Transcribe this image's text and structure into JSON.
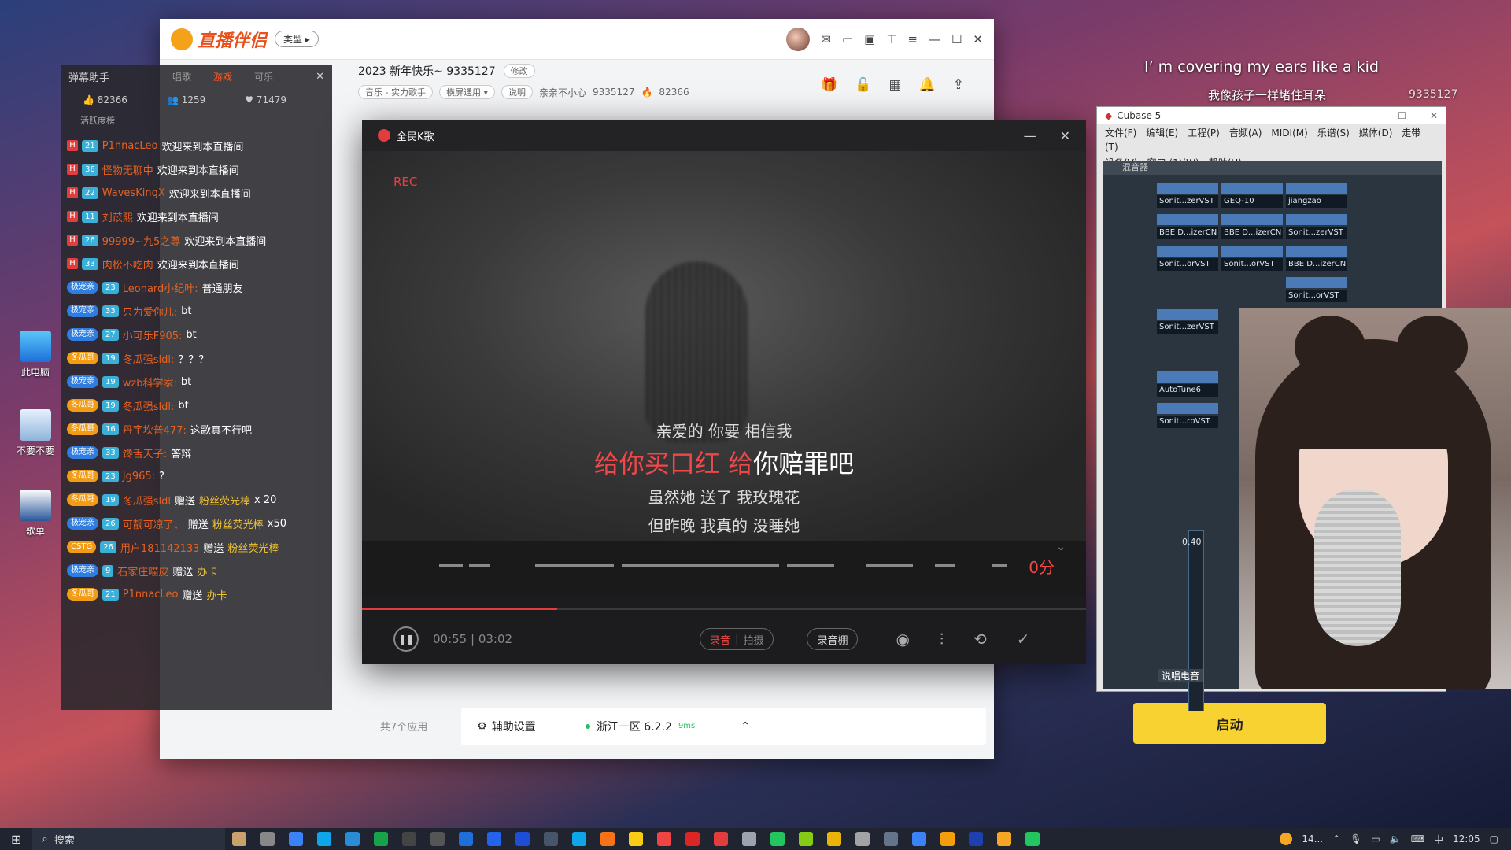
{
  "desktop": {
    "icons": [
      {
        "label": "此电脑"
      },
      {
        "label": "不要不要"
      },
      {
        "label": "歌单"
      }
    ],
    "overlay_lines": [
      "I’ m covering my ears like a kid",
      "我像孩子一样堵住耳朵"
    ],
    "watermark_room": "9335127"
  },
  "main_window": {
    "logo_text": "直播伴侣",
    "type_label": "类型 ▸",
    "chat": {
      "panel_title": "弹幕助手",
      "tabs": [
        "唱歌",
        "游戏",
        "可乐"
      ],
      "active_tab": "游戏",
      "stats": {
        "likes": "82366",
        "viewers": "1259",
        "hearts": "71479"
      },
      "activity_label": "活跃度榜",
      "messages": [
        {
          "kind": "welcome",
          "level": "21",
          "nick": "P1nnacLeo",
          "text": "欢迎来到本直播间"
        },
        {
          "kind": "welcome",
          "level": "36",
          "nick": "怪物无聊中",
          "text": "欢迎来到本直播间"
        },
        {
          "kind": "welcome",
          "level": "22",
          "nick": "WavesKingX",
          "text": "欢迎来到本直播间"
        },
        {
          "kind": "welcome",
          "level": "11",
          "nick": "刘苡熙",
          "text": "欢迎来到本直播间"
        },
        {
          "kind": "welcome",
          "level": "26",
          "nick": "99999~九5之尊",
          "text": "欢迎来到本直播间"
        },
        {
          "kind": "welcome",
          "level": "33",
          "nick": "肉松不吃肉",
          "text": "欢迎来到本直播间"
        },
        {
          "kind": "chat",
          "fan": "极宠亲",
          "level": "23",
          "nick": "Leonard小纪叶:",
          "text": "普通朋友"
        },
        {
          "kind": "chat",
          "fan": "极宠亲",
          "level": "33",
          "nick": "只为爱你儿:",
          "text": "bt"
        },
        {
          "kind": "chat",
          "fan": "极宠亲",
          "level": "27",
          "nick": "小可乐F905:",
          "text": "bt"
        },
        {
          "kind": "chat",
          "fan": "冬瓜哥",
          "level": "19",
          "nick": "冬瓜强sldl:",
          "text": "？？？"
        },
        {
          "kind": "chat",
          "fan": "极宠亲",
          "level": "19",
          "nick": "wzb科学家:",
          "text": "bt"
        },
        {
          "kind": "chat",
          "fan": "冬瓜哥",
          "level": "19",
          "nick": "冬瓜强sldl:",
          "text": "bt"
        },
        {
          "kind": "chat",
          "fan": "冬瓜哥",
          "level": "16",
          "nick": "丹宇坎普477:",
          "text": "这歌真不行吧"
        },
        {
          "kind": "chat",
          "fan": "极宠亲",
          "level": "33",
          "nick": "馋舌天子:",
          "text": "答辩"
        },
        {
          "kind": "chat",
          "fan": "冬瓜哥",
          "level": "23",
          "nick": "Jg965:",
          "text": "?"
        }
      ],
      "gifts": [
        {
          "fan": "冬瓜哥",
          "level": "19",
          "nick": "冬瓜强sldl",
          "verb": "赠送",
          "item": "粉丝荧光棒",
          "qty": "x 20"
        },
        {
          "fan": "极宠亲",
          "level": "26",
          "nick": "可靓可凉了、",
          "verb": "赠送",
          "item": "粉丝荧光棒",
          "qty": "x50"
        },
        {
          "fan": "CSTG",
          "level": "26",
          "nick": "用户181142133",
          "verb": "赠送",
          "item": "粉丝荧光棒",
          "qty": ""
        },
        {
          "fan": "极宠亲",
          "level": "9",
          "nick": "石家庄喵皮",
          "verb": "赠送",
          "item": "办卡",
          "qty": ""
        },
        {
          "fan": "冬瓜哥",
          "level": "21",
          "nick": "P1nnacLeo",
          "verb": "赠送",
          "item": "办卡",
          "qty": ""
        }
      ]
    },
    "room": {
      "title": "2023 新年快乐~ 9335127",
      "edit_label": "修改",
      "category": "音乐 - 实力歌手",
      "layout": "横屏通用 ▾",
      "desc_label": "说明",
      "streamer": "亲亲不小心",
      "room_id": "9335127",
      "heat": "82366"
    },
    "bottom": {
      "apps_count": "共7个应用",
      "assist_label": "辅助设置",
      "server": "浙江一区 6.2.2",
      "ping": "9ms",
      "start_label": "启动"
    }
  },
  "karaoke": {
    "title": "全民K歌",
    "rec_label": "REC",
    "lyrics": {
      "line1": "亲爱的 你要 相信我",
      "line2_sung": "给你买口红 给",
      "line2_rest": "你赔罪吧",
      "line3": "虽然她 送了 我玫瑰花",
      "line4": "但昨晚 我真的 没睡她"
    },
    "score": "0分",
    "progress_fraction": 0.27,
    "time": "00:55 | 03:02",
    "record_on": "录音",
    "record_off": "拍摄",
    "booth_label": "录音棚"
  },
  "cubase": {
    "title": "Cubase 5",
    "menu_row1": [
      "文件(F)",
      "编辑(E)",
      "工程(P)",
      "音频(A)",
      "MIDI(M)",
      "乐谱(S)",
      "媒体(D)",
      "走带(T)"
    ],
    "menu_row2": [
      "设备(V)",
      "窗口 (1)(W)",
      "帮助(H)"
    ],
    "mixer_title": "混音器",
    "inserts": [
      "Sonit...zerVST",
      "GEQ-10",
      "jiangzao",
      "BBE D...izerCN",
      "BBE D...izerCN",
      "Sonit...zerVST",
      "Sonit...orVST",
      "Sonit...orVST",
      "BBE D...izerCN",
      "Sonit...orVST",
      "Sonit...zerVST",
      "AutoTune6",
      "Sonit...rbVST"
    ],
    "fader_value": "0.40",
    "channel_label": "说唱电音"
  },
  "taskbar": {
    "search_placeholder": "搜索",
    "temp": "14...",
    "ime": "中",
    "clock": "12:05"
  }
}
